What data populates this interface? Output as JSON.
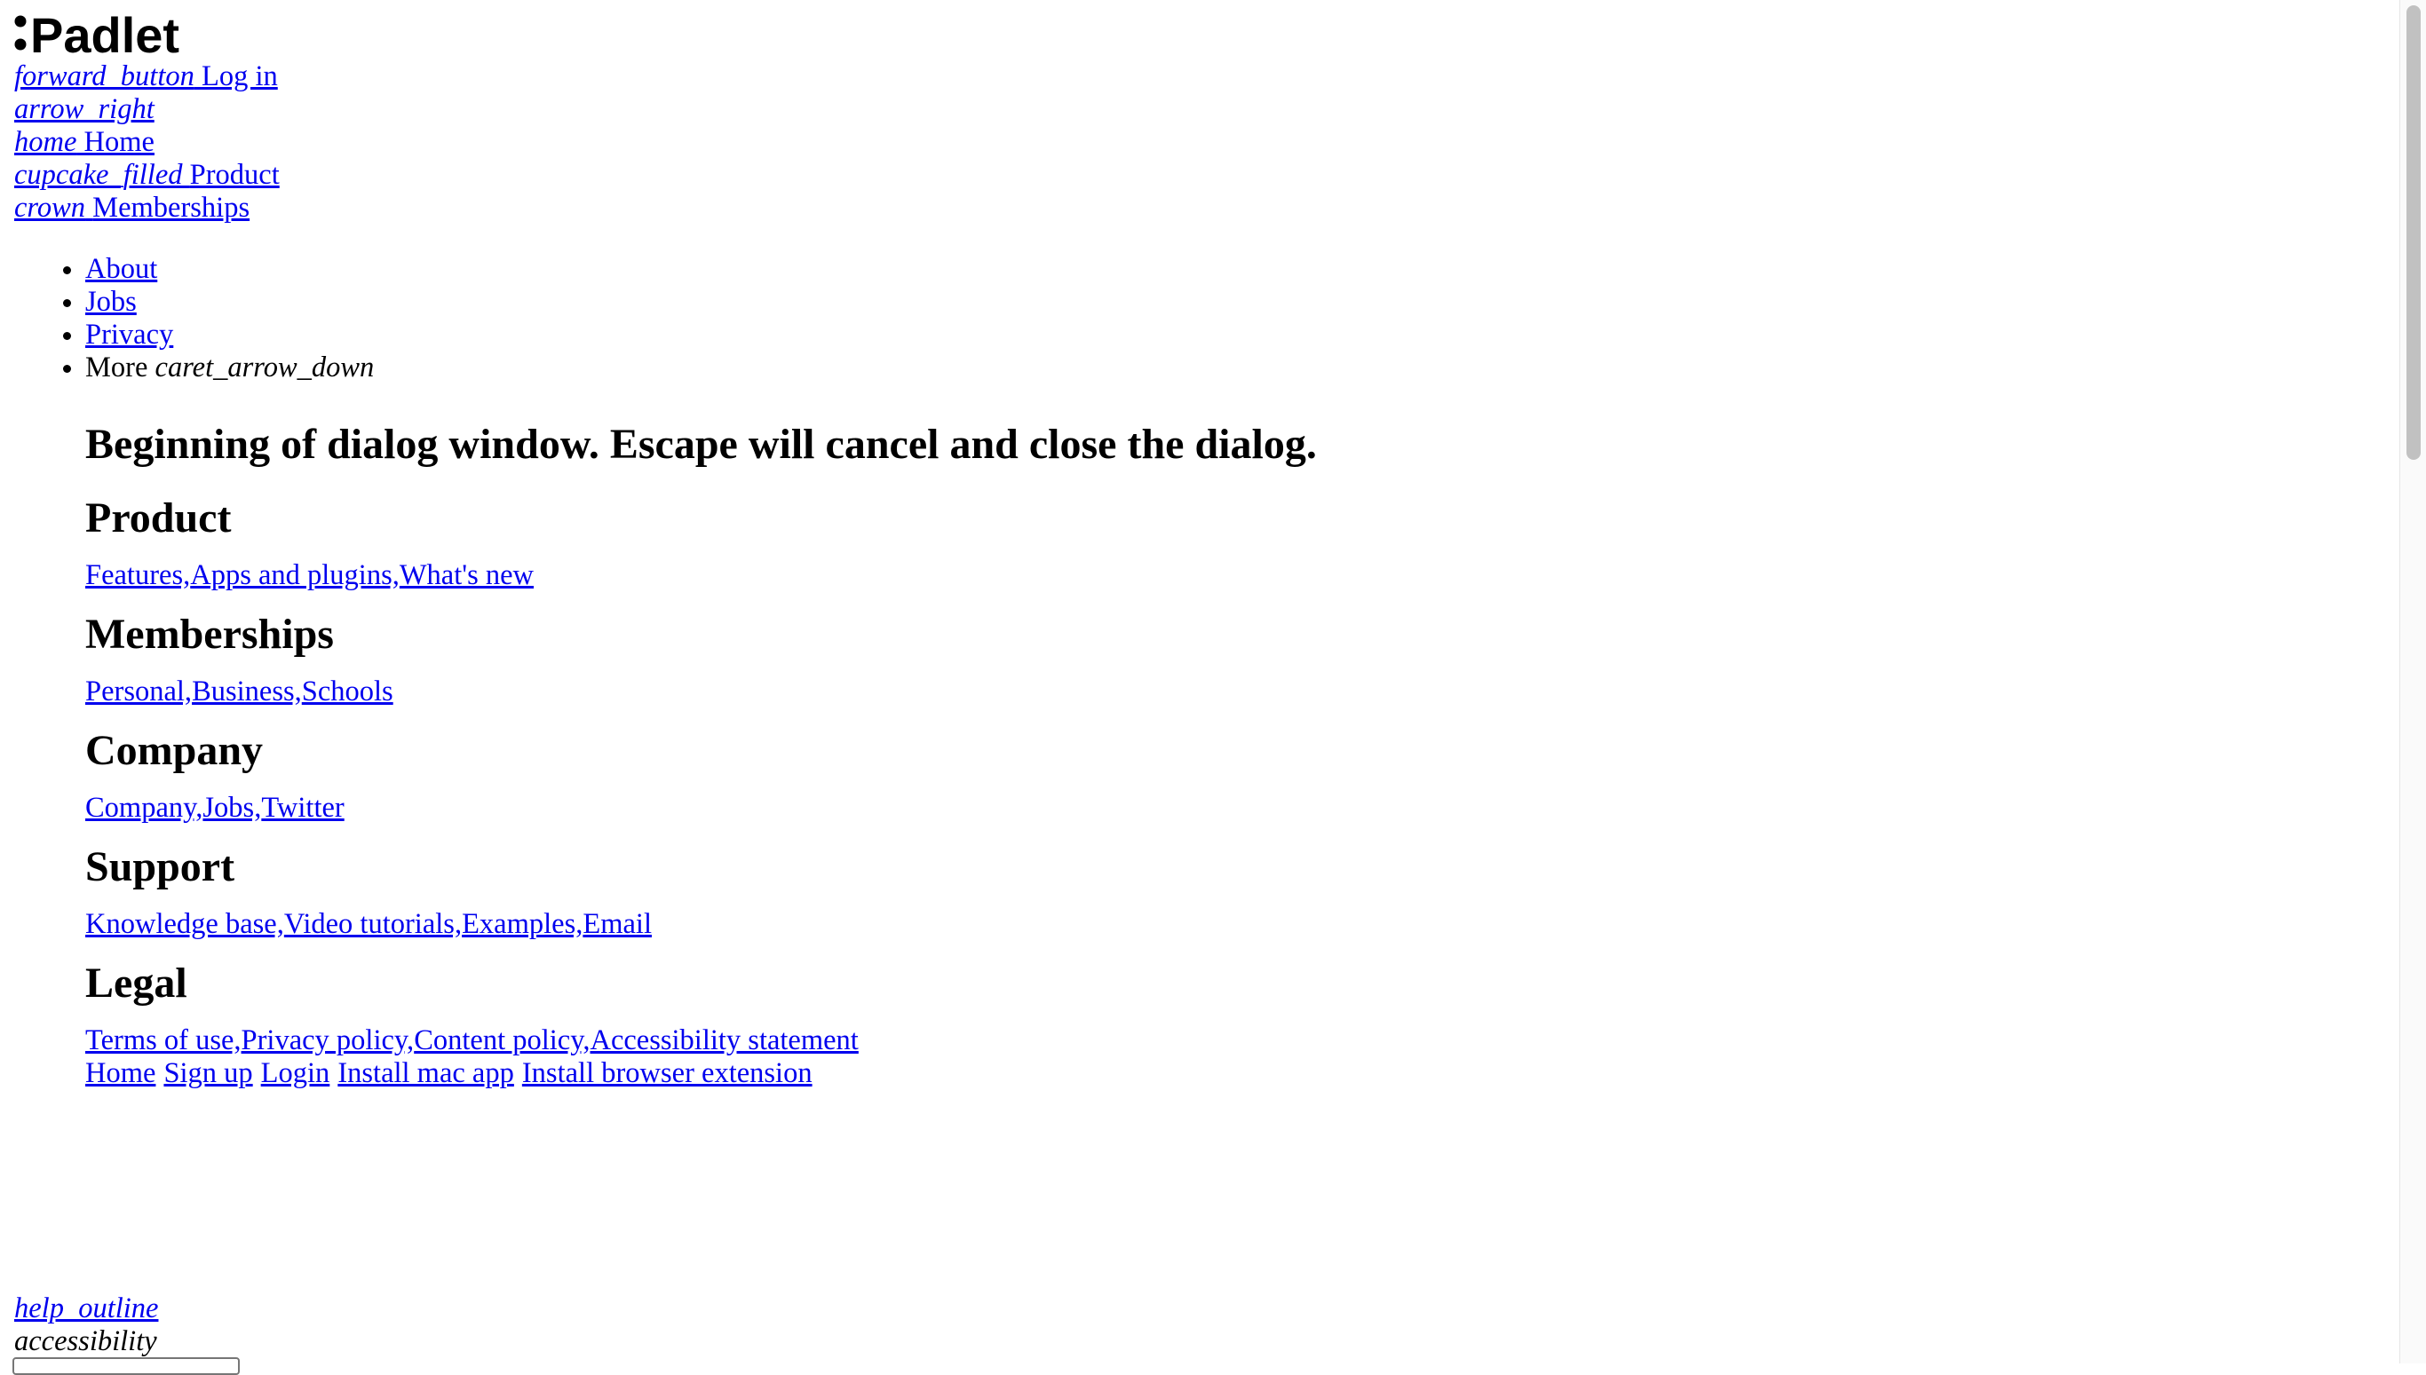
{
  "logo": {
    "name": "Padlet",
    "icon": "padlet-colon-logo"
  },
  "topnav": {
    "login": {
      "icon_text": "forward_button",
      "label": "Log in"
    },
    "arrow": {
      "icon_text": "arrow_right"
    },
    "home": {
      "icon_text": "home",
      "label": "Home"
    },
    "product": {
      "icon_text": "cupcake_filled",
      "label": "Product"
    },
    "memberships": {
      "icon_text": "crown",
      "label": "Memberships"
    }
  },
  "links": {
    "about": "About",
    "jobs": "Jobs",
    "privacy": "Privacy",
    "more": "More",
    "more_icon_text": "caret_arrow_down"
  },
  "dialog": {
    "title": "Beginning of dialog window. Escape will cancel and close the dialog.",
    "sections": [
      {
        "heading": "Product",
        "links": [
          "Features,",
          "Apps and plugins,",
          "What's new"
        ]
      },
      {
        "heading": "Memberships",
        "links": [
          "Personal,",
          "Business,",
          "Schools"
        ]
      },
      {
        "heading": "Company",
        "links": [
          "Company,",
          "Jobs,",
          "Twitter"
        ]
      },
      {
        "heading": "Support",
        "links": [
          "Knowledge base,",
          "Video tutorials,",
          "Examples,",
          "Email"
        ]
      },
      {
        "heading": "Legal",
        "links": [
          "Terms of use,",
          "Privacy policy,",
          "Content policy,",
          "Accessibility statement"
        ]
      }
    ],
    "bottom_links": [
      "Home",
      "Sign up",
      "Login",
      "Install mac app",
      "Install browser extension"
    ]
  },
  "footer": {
    "help_icon_text": "help_outline",
    "accessibility_icon_text": "accessibility"
  },
  "colors": {
    "link": "#0000ee",
    "text": "#000000",
    "background": "#ffffff",
    "scroll_thumb": "#c1c1c1"
  }
}
